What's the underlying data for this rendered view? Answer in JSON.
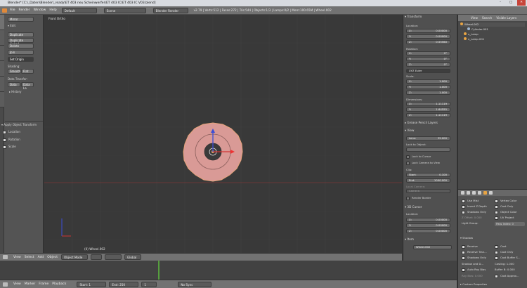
{
  "window": {
    "title": "Blender* [C:\\_Daten\\Blender\\_ready\\ET 403 neu Scheinwerfer\\ET 403 IC\\ET 403 IC V03.blend]",
    "buttons": [
      "–",
      "□",
      "✕"
    ]
  },
  "topbar": {
    "menus": [
      "File",
      "Render",
      "Window",
      "Help"
    ],
    "layout": "Default",
    "scene": "Scene",
    "engine": "Blender Render",
    "stats": "v2.79 | Verts:512 | Faces:272 | Tris:544 | Objects:1/3 | Lamps:0/2 | Mem:100.65M | Wheel.002"
  },
  "toolshelf": {
    "tabs": [
      "Tools",
      "Create",
      "Relations",
      "Animation",
      "Physics",
      "Grease Pencil"
    ],
    "rows": [
      {
        "type": "button",
        "label": "Mirror"
      },
      {
        "type": "label",
        "label": "▾ Edit"
      },
      {
        "type": "button",
        "label": "Duplicate"
      },
      {
        "type": "button",
        "label": "Duplicate Linked"
      },
      {
        "type": "button",
        "label": "Delete"
      },
      {
        "type": "button",
        "label": "Join"
      },
      {
        "type": "select",
        "label": "Set Origin"
      }
    ],
    "shading_label": "Shading:",
    "shading_buttons": [
      "Smooth",
      "Flat"
    ],
    "data_transfer_label": "Data Transfer:",
    "data_buttons": [
      "Data",
      "Data La"
    ],
    "history": "▸ History",
    "operator_panel": {
      "title": "▾ Apply Object Transform",
      "options": [
        {
          "label": "Location",
          "checked": true
        },
        {
          "label": "Rotation",
          "checked": true
        },
        {
          "label": "Scale",
          "checked": true
        }
      ]
    }
  },
  "viewport": {
    "view_label": "Front Ortho",
    "object_label": "(0) Wheel.002"
  },
  "viewport_header": {
    "items": [
      "View",
      "Select",
      "Add",
      "Object"
    ],
    "mode": "Object Mode",
    "orientation": "Global"
  },
  "properties": {
    "transform_header": "▾ Transform",
    "location_label": "Location:",
    "location": [
      {
        "axis": "X:",
        "value": "0.00000"
      },
      {
        "axis": "Y:",
        "value": "0.00000"
      },
      {
        "axis": "Z:",
        "value": "0.55560"
      }
    ],
    "rotation_label": "Rotation:",
    "rotation": [
      {
        "axis": "X:",
        "value": "0°"
      },
      {
        "axis": "Y:",
        "value": "0°"
      },
      {
        "axis": "Z:",
        "value": "0°"
      }
    ],
    "rotation_mode": "XYZ Euler",
    "scale_label": "Scale:",
    "scale": [
      {
        "axis": "X:",
        "value": "1.000"
      },
      {
        "axis": "Y:",
        "value": "1.000"
      },
      {
        "axis": "Z:",
        "value": "1.000"
      }
    ],
    "dimensions_label": "Dimensions:",
    "dimensions": [
      {
        "axis": "X:",
        "value": "1.11119"
      },
      {
        "axis": "Y:",
        "value": "1.64555"
      },
      {
        "axis": "Z:",
        "value": "1.11119"
      }
    ],
    "grease_pencil": "▸ Grease Pencil Layers",
    "view_header": "▾ View",
    "lens": {
      "label": "Lens:",
      "value": "35.000"
    },
    "lock_to_object": "Lock to Object:",
    "lock_to_cursor": "Lock to Cursor",
    "lock_camera": "Lock Camera to View",
    "clip_label": "Clip:",
    "clip_start": {
      "label": "Start:",
      "value": "0.100"
    },
    "clip_end": {
      "label": "End:",
      "value": "1000.000"
    },
    "local_camera": "Local Camera:",
    "camera": "Camera",
    "render_border": "Render Border",
    "cursor_header": "▾ 3D Cursor",
    "cursor_location_label": "Location:",
    "cursor": [
      {
        "axis": "X:",
        "value": "0.00000"
      },
      {
        "axis": "Y:",
        "value": "0.00000"
      },
      {
        "axis": "Z:",
        "value": "0.00000"
      }
    ],
    "item_header": "▾ Item",
    "item_name": "Wheel.002"
  },
  "outliner": {
    "menus": [
      "View",
      "Search",
      "Visible Layers"
    ],
    "rows": [
      {
        "label": "Wheel.002",
        "indent": 0,
        "dot": "#e8a443"
      },
      {
        "label": "Cylinder.001",
        "indent": 2,
        "dot": "#9fb6d0"
      },
      {
        "label": "x_Lamp",
        "indent": 1,
        "dot": "#e8a443"
      },
      {
        "label": "x_Lamp.001",
        "indent": 1,
        "dot": "#e8a443"
      }
    ]
  },
  "properties_editor": {
    "left_column": [
      "Use Mist",
      "Invert Z Depth",
      "Shadows Only",
      "Receive Tran...",
      "Z Offset: 0.000"
    ],
    "right_column": [
      "Vertex Color",
      "Cast Only",
      "Object Color",
      "UV Project"
    ],
    "light_group": "Light Group:",
    "pass_index": "Pass Index: 0",
    "shadow_header": "▾ Shadow",
    "shadow_left": [
      "Receive",
      "Receive Tran...",
      "Shadows Only",
      "Shadow and D...",
      "Auto Ray Bias",
      "Ray Bias: 0.000"
    ],
    "shadow_right": [
      "Cast",
      "Cast Only",
      "Cast Buffer S...",
      "Casting: 1.000",
      "Buffer B: 0.000",
      "Cast Approx..."
    ],
    "custom_properties": "▸ Custom Properties"
  },
  "timeline_header": {
    "items": [
      "View",
      "Marker",
      "Frame",
      "Playback"
    ],
    "start": {
      "label": "Start:",
      "value": "1"
    },
    "end": {
      "label": "End:",
      "value": "250"
    },
    "current": "1",
    "sync": "No Sync"
  }
}
